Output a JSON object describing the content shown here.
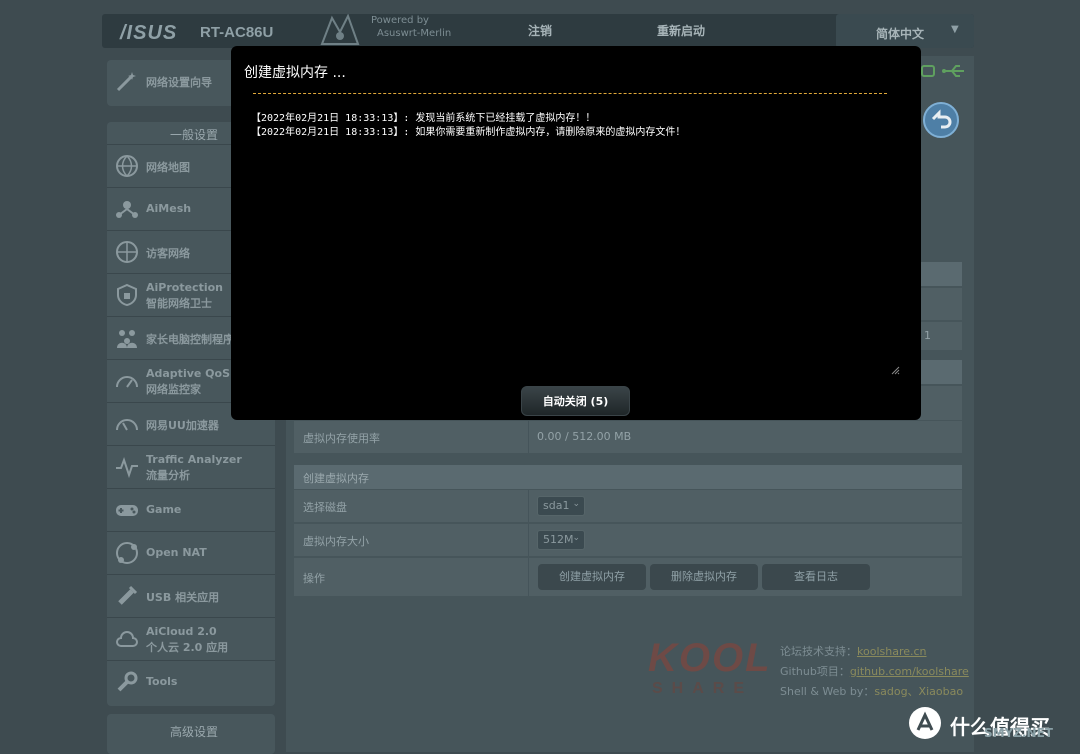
{
  "header": {
    "logo": "/ISUS",
    "model": "RT-AC86U",
    "powered_by_1": "Powered by",
    "powered_by_2": "Asuswrt-Merlin",
    "logout": "注销",
    "reboot": "重新启动",
    "language": "简体中文"
  },
  "sidebar": {
    "quick_setup": "网络设置向导",
    "general_title": "一般设置",
    "items": [
      {
        "icon": "globe-icon",
        "line1": "网络地图",
        "line2": ""
      },
      {
        "icon": "mesh-icon",
        "line1": "AiMesh",
        "line2": ""
      },
      {
        "icon": "guest-network-icon",
        "line1": "访客网络",
        "line2": ""
      },
      {
        "icon": "shield-icon",
        "line1": "AiProtection",
        "line2": "智能网络卫士"
      },
      {
        "icon": "family-icon",
        "line1": "家长电脑控制程序",
        "line2": ""
      },
      {
        "icon": "gauge-icon",
        "line1": "Adaptive QoS",
        "line2": "网络监控家"
      },
      {
        "icon": "speedometer-icon",
        "line1": "网易UU加速器",
        "line2": ""
      },
      {
        "icon": "pulse-icon",
        "line1": "Traffic Analyzer",
        "line2": "流量分析"
      },
      {
        "icon": "gamepad-icon",
        "line1": "Game",
        "line2": ""
      },
      {
        "icon": "nat-globe-icon",
        "line1": "Open NAT",
        "line2": ""
      },
      {
        "icon": "usb-icon",
        "line1": "USB 相关应用",
        "line2": ""
      },
      {
        "icon": "cloud-icon",
        "line1": "AiCloud 2.0",
        "line2": "个人云 2.0 应用"
      },
      {
        "icon": "wrench-icon",
        "line1": "Tools",
        "line2": ""
      }
    ],
    "advanced_title": "高级设置"
  },
  "main": {
    "swap_usage_label": "虚拟内存使用率",
    "swap_usage_value": "0.00 / 512.00 MB",
    "create_section_title": "创建虚拟内存",
    "disk_label": "选择磁盘",
    "disk_value": "sda1",
    "size_label": "虚拟内存大小",
    "size_value": "512M",
    "action_label": "操作",
    "btn_create": "创建虚拟内存",
    "btn_delete": "删除虚拟内存",
    "btn_log": "查看日志",
    "partial_digit": "1"
  },
  "footer": {
    "kool": "KOOL",
    "share": "SHARE",
    "forum_label": "论坛技术支持：",
    "forum_value": "koolshare.cn",
    "github_label": "Github项目：",
    "github_value": "github.com/koolshare",
    "dev_label": "Shell & Web by：",
    "dev_value": "sadog、Xiaobao"
  },
  "watermark": {
    "text": "什么值得买",
    "site": "SMYZ.NET"
  },
  "modal": {
    "title": "创建虚拟内存 ...",
    "log_lines": [
      "【2022年02月21日 18:33:13】: 发现当前系统下已经挂载了虚拟内存！！",
      "【2022年02月21日 18:33:13】: 如果你需要重新制作虚拟内存，请删除原来的虚拟内存文件！"
    ],
    "close_button": "自动关闭 (5)"
  },
  "colors": {
    "background": "#3e4b50",
    "modal_bg": "#000000",
    "divider_accent": "#e0a83a"
  }
}
